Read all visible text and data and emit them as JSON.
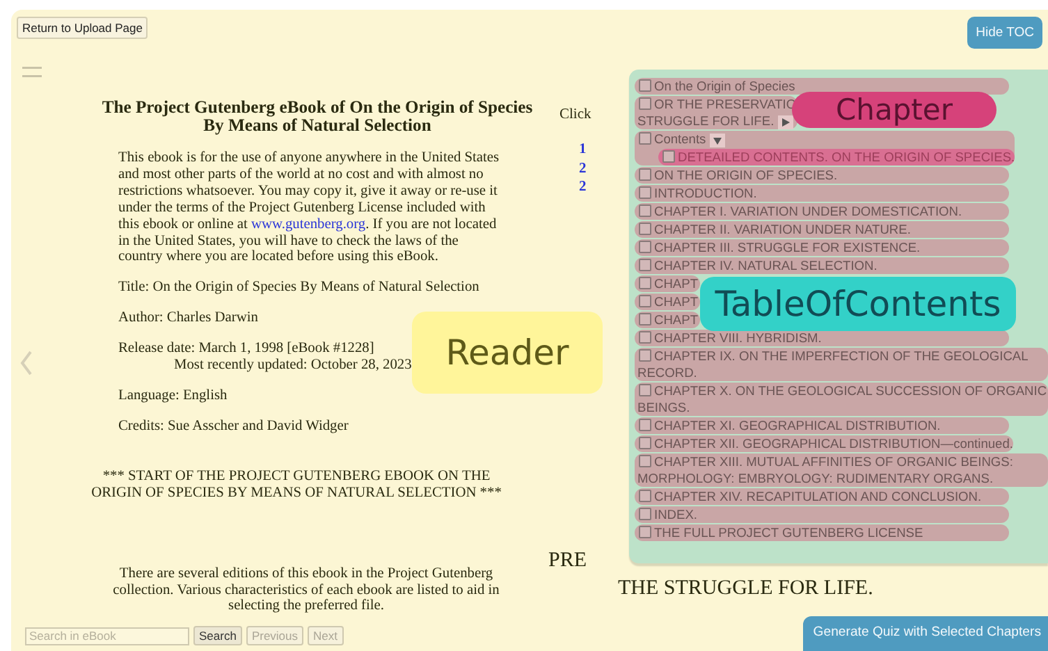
{
  "toolbar": {
    "return_button": "Return to Upload Page",
    "toc_button": "Hide TOC"
  },
  "reader": {
    "title_lines": [
      "The Project Gutenberg eBook of On the Origin of Species",
      "By Means of Natural Selection"
    ],
    "intro": {
      "before": "This ebook is for the use of anyone anywhere in the United States and most other parts of the world at no cost and with almost no restrictions whatsoever. You may copy it, give it away or re-use it under the terms of the Project Gutenberg License included with this ebook or online at ",
      "link": "www.gutenberg.org",
      "after": ". If you are not located in the United States, you will have to check the laws of the country where you are located before using this eBook."
    },
    "fields": [
      {
        "kind": "line",
        "text": "Title: On the Origin of Species By Means of Natural Selection"
      },
      {
        "kind": "line",
        "text": "Author: Charles Darwin"
      },
      {
        "kind": "line",
        "text": "Release date: March 1, 1998 [eBook #1228]"
      },
      {
        "kind": "continued",
        "text": "Most recently updated: October 28, 2023"
      },
      {
        "kind": "line",
        "text": "Language: English"
      },
      {
        "kind": "line",
        "text": "Credits: Sue Asscher and David Widger"
      }
    ],
    "start_marker": "*** START OF THE PROJECT GUTENBERG EBOOK ON THE ORIGIN OF SPECIES BY MEANS OF NATURAL SELECTION ***",
    "editions_note": "There are several editions of this ebook in the Project Gutenberg collection. Various characteristics of each ebook are listed to aid in selecting the preferred file."
  },
  "next_page": {
    "lines": [
      {
        "kind": "text",
        "text": "Click"
      },
      {
        "kind": "link",
        "text": "1"
      },
      {
        "kind": "link",
        "text": "2"
      },
      {
        "kind": "link",
        "text": "2"
      }
    ],
    "heading": "PRE",
    "subheading": "THE STRUGGLE FOR LIFE."
  },
  "toc": {
    "items": [
      {
        "label": "On the Origin of Species",
        "checked": false,
        "selected": false
      },
      {
        "label": "OR THE PRESERVATIO",
        "label_continued": "STRUGGLE FOR LIFE.",
        "checked": false,
        "selected": false,
        "expanded": false,
        "kind": "partial"
      },
      {
        "label": "Contents",
        "checked": false,
        "selected": false,
        "expanded": true,
        "children": [
          {
            "label": "DETEAILED CONTENTS. ON THE ORIGIN OF SPECIES.",
            "checked": false,
            "selected": true
          }
        ]
      },
      {
        "label": "ON THE ORIGIN OF SPECIES.",
        "checked": false,
        "selected": false
      },
      {
        "label": "INTRODUCTION.",
        "checked": false,
        "selected": false
      },
      {
        "label": "CHAPTER I. VARIATION UNDER DOMESTICATION.",
        "checked": false,
        "selected": false
      },
      {
        "label": "CHAPTER II. VARIATION UNDER NATURE.",
        "checked": false,
        "selected": false
      },
      {
        "label": "CHAPTER III. STRUGGLE FOR EXISTENCE.",
        "checked": false,
        "selected": false
      },
      {
        "label": "CHAPTER IV. NATURAL SELECTION.",
        "checked": false,
        "selected": false
      },
      {
        "label": "CHAPT",
        "checked": false,
        "selected": false,
        "kind": "partial"
      },
      {
        "label": "CHAPT",
        "checked": false,
        "selected": false,
        "kind": "partial"
      },
      {
        "label": "CHAPT",
        "checked": false,
        "selected": false,
        "kind": "partial"
      },
      {
        "label": "CHAPTER VIII. HYBRIDISM.",
        "checked": false,
        "selected": false
      },
      {
        "label": "CHAPTER IX. ON THE IMPERFECTION OF THE GEOLOGICAL RECORD.",
        "checked": false,
        "selected": false
      },
      {
        "label": "CHAPTER X. ON THE GEOLOGICAL SUCCESSION OF ORGANIC BEINGS.",
        "checked": false,
        "selected": false
      },
      {
        "label": "CHAPTER XI. GEOGRAPHICAL DISTRIBUTION.",
        "checked": false,
        "selected": false
      },
      {
        "label": "CHAPTER XII. GEOGRAPHICAL DISTRIBUTION—continued.",
        "checked": false,
        "selected": false
      },
      {
        "label": "CHAPTER XIII. MUTUAL AFFINITIES OF ORGANIC BEINGS: MORPHOLOGY: EMBRYOLOGY: RUDIMENTARY ORGANS.",
        "checked": false,
        "selected": false
      },
      {
        "label": "CHAPTER XIV. RECAPITULATION AND CONCLUSION.",
        "checked": false,
        "selected": false
      },
      {
        "label": "INDEX.",
        "checked": false,
        "selected": false
      },
      {
        "label": "THE FULL PROJECT GUTENBERG LICENSE",
        "checked": false,
        "selected": false
      }
    ]
  },
  "search": {
    "placeholder": "Search in eBook",
    "buttons": [
      {
        "label": "Search",
        "disabled": false
      },
      {
        "label": "Previous",
        "disabled": true
      },
      {
        "label": "Next",
        "disabled": true
      }
    ]
  },
  "quiz_button": "Generate Quiz with Selected Chapters",
  "annotations": [
    {
      "label": "Reader",
      "color": "#fff59a"
    },
    {
      "label": "Chapter",
      "color": "#d6427a"
    },
    {
      "label": "TableOfContents",
      "color": "#33d1c8"
    }
  ]
}
